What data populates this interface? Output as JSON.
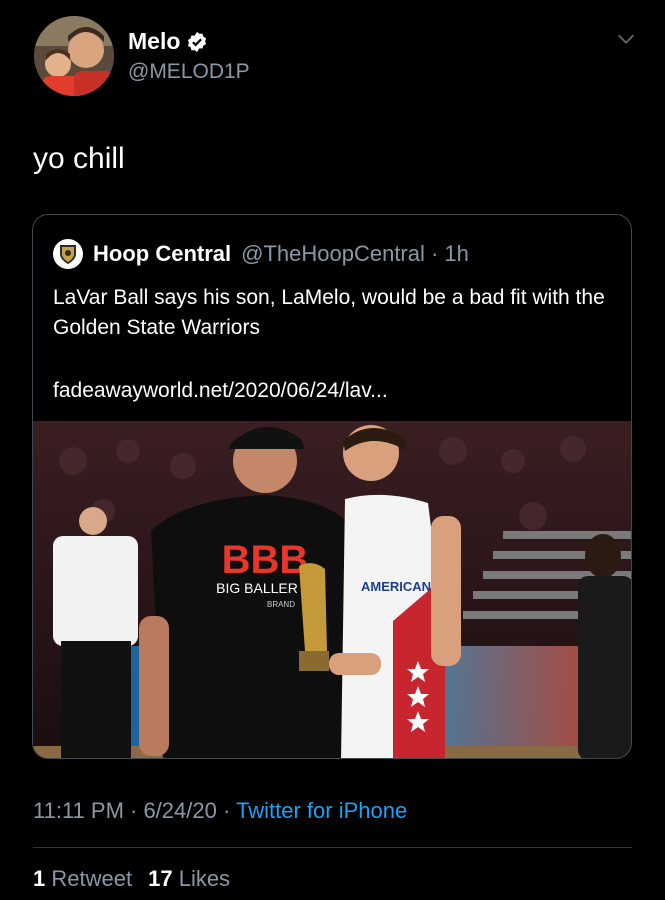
{
  "author": {
    "name": "Melo",
    "handle": "@MELOD1P"
  },
  "tweet": {
    "text": "yo chill",
    "timestamp": "11:11 PM · 6/24/20 · ",
    "source": "Twitter for iPhone"
  },
  "quoted": {
    "name": "Hoop Central",
    "meta": "@TheHoopCentral · 1h",
    "text": "LaVar Ball says his son, LaMelo, would be a bad fit with the Golden State Warriors",
    "link": "fadeawayworld.net/2020/06/24/lav...",
    "photo": {
      "shirt_logo": "BBB",
      "shirt_text": "BIG BALLER",
      "shirt_sub": "BRAND",
      "jersey_text": "AMERICAN"
    }
  },
  "stats": {
    "retweets_count": "1",
    "retweets_label": "Retweet",
    "likes_count": "17",
    "likes_label": "Likes"
  },
  "colors": {
    "background": "#000000",
    "secondary_text": "#8899a6",
    "link": "#1da1f2",
    "verified": "#ffffff"
  }
}
